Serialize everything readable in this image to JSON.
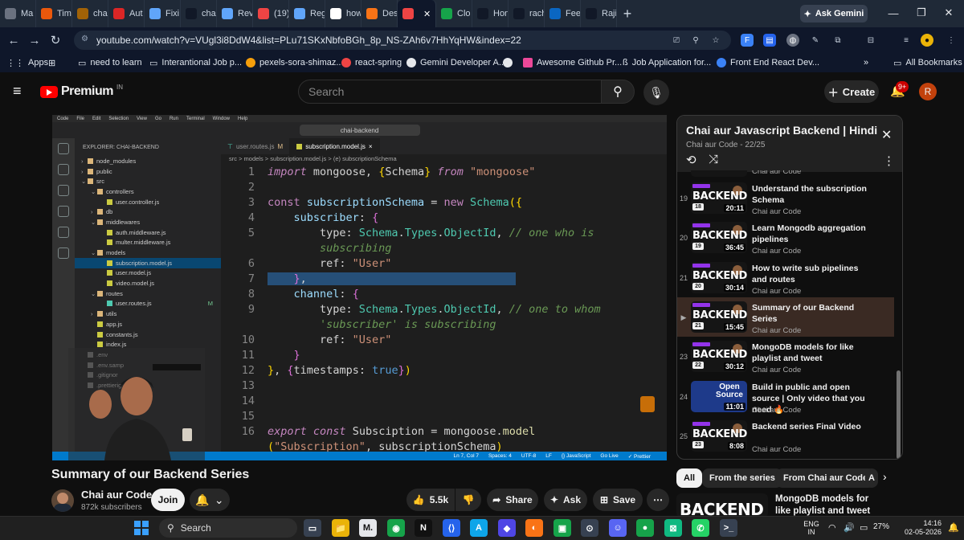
{
  "browser": {
    "tabs": [
      {
        "label": "Ma",
        "icon": "app-icon",
        "color": "#6b7280"
      },
      {
        "label": "Tim",
        "icon": "bookmark-icon",
        "color": "#ea580c"
      },
      {
        "label": "cha",
        "icon": "chai-icon",
        "color": "#a16207"
      },
      {
        "label": "Aut",
        "icon": "card-icon",
        "color": "#dc2626"
      },
      {
        "label": "Fixi",
        "icon": "gemini-icon",
        "color": "#60a5fa"
      },
      {
        "label": "cha",
        "icon": "github-icon",
        "color": "#111827"
      },
      {
        "label": "Rev",
        "icon": "gemini-icon",
        "color": "#60a5fa"
      },
      {
        "label": "(19)",
        "icon": "youtube-icon",
        "color": "#ef4444"
      },
      {
        "label": "Reg",
        "icon": "gemini-icon",
        "color": "#60a5fa"
      },
      {
        "label": "how",
        "icon": "google-icon",
        "color": "#ffffff"
      },
      {
        "label": "Desi",
        "icon": "claude-icon",
        "color": "#f97316"
      },
      {
        "label": "",
        "icon": "youtube-icon",
        "color": "#ef4444",
        "active": true
      },
      {
        "label": "Clo",
        "icon": "leaf-icon",
        "color": "#16a34a"
      },
      {
        "label": "Hon",
        "icon": "x-icon",
        "color": "#111827"
      },
      {
        "label": "rach",
        "icon": "github-icon",
        "color": "#111827"
      },
      {
        "label": "Fee",
        "icon": "linkedin-icon",
        "color": "#0a66c2"
      },
      {
        "label": "Rajil",
        "icon": "github-icon",
        "color": "#111827"
      }
    ],
    "ask_gemini": "Ask Gemini",
    "url": "youtube.com/watch?v=VUgl3i8DdW4&list=PLu71SKxNbfoBGh_8p_NS-ZAh6v7HhYqHW&index=22",
    "bookmarks": [
      {
        "label": "Apps",
        "color": "#9ca3af"
      },
      {
        "label": "need to learn",
        "color": "#9ca3af"
      },
      {
        "label": "Interantional Job p...",
        "color": "#9ca3af"
      },
      {
        "label": "pexels-sora-shimaz...",
        "color": "#f59e0b"
      },
      {
        "label": "react-spring",
        "color": "#ef4444"
      },
      {
        "label": "Gemini Developer A...",
        "color": "#e5e7eb"
      },
      {
        "label": "",
        "color": "#6b7280"
      },
      {
        "label": "Awesome Github Pr...",
        "color": "#ec4899"
      },
      {
        "label": "Job Application for...",
        "color": "#9ca3af"
      },
      {
        "label": "Front End React Dev...",
        "color": "#3b82f6"
      }
    ],
    "all_bookmarks": "All Bookmarks",
    "overflow": "»"
  },
  "youtube": {
    "logo": "Premium",
    "region": "IN",
    "search_placeholder": "Search",
    "create_label": "Create",
    "notifications": "9+",
    "avatar_letter": "R"
  },
  "video_frame": {
    "mac_menu": [
      "Code",
      "File",
      "Edit",
      "Selection",
      "View",
      "Go",
      "Run",
      "Terminal",
      "Window",
      "Help"
    ],
    "search": "chai-backend",
    "explorer_title": "EXPLORER: CHAI-BACKEND",
    "tree": [
      {
        "label": "node_modules",
        "indent": 0,
        "kind": "folder"
      },
      {
        "label": "public",
        "indent": 0,
        "kind": "folder"
      },
      {
        "label": "src",
        "indent": 0,
        "kind": "folder-open"
      },
      {
        "label": "controllers",
        "indent": 1,
        "kind": "folder-open"
      },
      {
        "label": "user.controller.js",
        "indent": 2,
        "kind": "js"
      },
      {
        "label": "db",
        "indent": 1,
        "kind": "folder"
      },
      {
        "label": "middlewares",
        "indent": 1,
        "kind": "folder-open"
      },
      {
        "label": "auth.middleware.js",
        "indent": 2,
        "kind": "js"
      },
      {
        "label": "multer.middleware.js",
        "indent": 2,
        "kind": "js"
      },
      {
        "label": "models",
        "indent": 1,
        "kind": "folder-open"
      },
      {
        "label": "subscription.model.js",
        "indent": 2,
        "kind": "js",
        "selected": true
      },
      {
        "label": "user.model.js",
        "indent": 2,
        "kind": "js"
      },
      {
        "label": "video.model.js",
        "indent": 2,
        "kind": "js"
      },
      {
        "label": "routes",
        "indent": 1,
        "kind": "folder-open"
      },
      {
        "label": "user.routes.js",
        "indent": 2,
        "kind": "route",
        "badge": "M"
      },
      {
        "label": "utils",
        "indent": 1,
        "kind": "folder"
      },
      {
        "label": "app.js",
        "indent": 1,
        "kind": "js"
      },
      {
        "label": "constants.js",
        "indent": 1,
        "kind": "js"
      },
      {
        "label": "index.js",
        "indent": 1,
        "kind": "js"
      },
      {
        "label": ".env",
        "indent": 0,
        "kind": "file"
      },
      {
        "label": ".env.samp",
        "indent": 0,
        "kind": "file"
      },
      {
        "label": ".gitignor",
        "indent": 0,
        "kind": "file"
      },
      {
        "label": ".prettierig",
        "indent": 0,
        "kind": "file"
      }
    ],
    "editor_tabs": [
      {
        "label": "user.routes.js",
        "badge": "M"
      },
      {
        "label": "subscription.model.js",
        "close": "×",
        "active": true
      }
    ],
    "breadcrumb": "src > models > subscription.model.js > (e) subscriptionSchema",
    "code_lines": [
      {
        "n": "1",
        "tokens": [
          [
            "kwi",
            "import"
          ],
          [
            "pl",
            " mongoose, "
          ],
          [
            "pn",
            "{"
          ],
          [
            "pl",
            "Schema"
          ],
          [
            "pn",
            "}"
          ],
          [
            "pl",
            " "
          ],
          [
            "kwi",
            "from"
          ],
          [
            "pl",
            " "
          ],
          [
            "st",
            "\"mongoose\""
          ]
        ]
      },
      {
        "n": "2",
        "tokens": []
      },
      {
        "n": "3",
        "tokens": [
          [
            "kw",
            "const"
          ],
          [
            "pl",
            " "
          ],
          [
            "id",
            "subscriptionSchema"
          ],
          [
            "pl",
            " = "
          ],
          [
            "kw",
            "new"
          ],
          [
            "pl",
            " "
          ],
          [
            "ty",
            "Schema"
          ],
          [
            "pn",
            "({"
          ]
        ]
      },
      {
        "n": "4",
        "tokens": [
          [
            "pl",
            "    "
          ],
          [
            "id",
            "subscriber"
          ],
          [
            "pl",
            ": "
          ],
          [
            "pk",
            "{"
          ]
        ]
      },
      {
        "n": "5",
        "tokens": [
          [
            "pl",
            "        type: "
          ],
          [
            "ty",
            "Schema"
          ],
          [
            "pl",
            "."
          ],
          [
            "ty",
            "Types"
          ],
          [
            "pl",
            "."
          ],
          [
            "ty",
            "ObjectId"
          ],
          [
            "pl",
            ", "
          ],
          [
            "cm",
            "// one who is"
          ]
        ]
      },
      {
        "n": "",
        "tokens": [
          [
            "pl",
            "        "
          ],
          [
            "cm",
            "subscribing"
          ]
        ]
      },
      {
        "n": "6",
        "tokens": [
          [
            "pl",
            "        ref: "
          ],
          [
            "st",
            "\"User\""
          ]
        ]
      },
      {
        "n": "7",
        "tokens": [
          [
            "pl",
            "    "
          ],
          [
            "pk",
            "}"
          ],
          [
            "pl",
            ","
          ]
        ],
        "hl": true
      },
      {
        "n": "8",
        "tokens": [
          [
            "pl",
            "    "
          ],
          [
            "id",
            "channel"
          ],
          [
            "pl",
            ": "
          ],
          [
            "pk",
            "{"
          ]
        ]
      },
      {
        "n": "9",
        "tokens": [
          [
            "pl",
            "        type: "
          ],
          [
            "ty",
            "Schema"
          ],
          [
            "pl",
            "."
          ],
          [
            "ty",
            "Types"
          ],
          [
            "pl",
            "."
          ],
          [
            "ty",
            "ObjectId"
          ],
          [
            "pl",
            ", "
          ],
          [
            "cm",
            "// one to whom"
          ]
        ]
      },
      {
        "n": "",
        "tokens": [
          [
            "pl",
            "        "
          ],
          [
            "cm",
            "'subscriber' is subscribing"
          ]
        ]
      },
      {
        "n": "10",
        "tokens": [
          [
            "pl",
            "        ref: "
          ],
          [
            "st",
            "\"User\""
          ]
        ]
      },
      {
        "n": "11",
        "tokens": [
          [
            "pl",
            "    "
          ],
          [
            "pk",
            "}"
          ]
        ]
      },
      {
        "n": "12",
        "tokens": [
          [
            "pn",
            "}"
          ],
          [
            "pl",
            ", "
          ],
          [
            "pk",
            "{"
          ],
          [
            "pl",
            "timestamps: "
          ],
          [
            "bl",
            "true"
          ],
          [
            "pk",
            "}"
          ],
          [
            "pn",
            ")"
          ]
        ]
      },
      {
        "n": "13",
        "tokens": []
      },
      {
        "n": "14",
        "tokens": []
      },
      {
        "n": "15",
        "tokens": []
      },
      {
        "n": "16",
        "tokens": [
          [
            "kwi",
            "export"
          ],
          [
            "pl",
            " "
          ],
          [
            "kwi",
            "const"
          ],
          [
            "pl",
            " Subsciption = mongoose."
          ],
          [
            "fn",
            "model"
          ]
        ]
      },
      {
        "n": "",
        "tokens": [
          [
            "pn",
            "("
          ],
          [
            "st",
            "\"Subscription\""
          ],
          [
            "pl",
            ", subscriptionSchema"
          ],
          [
            "pn",
            ")"
          ]
        ]
      }
    ],
    "status": [
      "Ln 7, Col 7",
      "Spaces: 4",
      "UTF-8",
      "LF",
      "{} JavaScript",
      "Go Live",
      "✓ Prettier"
    ]
  },
  "video": {
    "title": "Summary of our Backend Series",
    "channel": "Chai aur Code",
    "subscribers": "872k subscribers",
    "join": "Join",
    "likes": "5.5k",
    "share": "Share",
    "ask": "Ask",
    "save": "Save"
  },
  "playlist": {
    "title": "Chai aur Javascript Backend | Hindi",
    "subtitle": "Chai aur Code - 22/25",
    "thumb_word": "BACKEND",
    "items": [
      {
        "index": "19",
        "num": "18",
        "duration": "20:11",
        "title": "Understand the subscription Schema",
        "channel": "Chai aur Code"
      },
      {
        "index": "20",
        "num": "19",
        "duration": "36:45",
        "title": "Learn Mongodb aggregation pipelines",
        "channel": "Chai aur Code"
      },
      {
        "index": "21",
        "num": "20",
        "duration": "30:14",
        "title": "How to write sub pipelines and routes",
        "channel": "Chai aur Code"
      },
      {
        "index": "▶",
        "num": "21",
        "duration": "15:45",
        "title": "Summary of our Backend Series",
        "channel": "Chai aur Code",
        "current": true
      },
      {
        "index": "23",
        "num": "22",
        "duration": "30:12",
        "title": "MongoDB models for like playlist and tweet",
        "channel": "Chai aur Code"
      },
      {
        "index": "24",
        "num": "",
        "duration": "11:01",
        "title": "Build in public and open source | Only video that you need 🔥",
        "channel": "Chai aur Code",
        "special": "Open Source"
      },
      {
        "index": "25",
        "num": "23",
        "duration": "8:08",
        "title": "Backend series Final Video",
        "channel": "Chai aur Code"
      }
    ]
  },
  "chips": [
    "All",
    "From the series",
    "From Chai aur Code",
    "A"
  ],
  "recommendation": {
    "title": "MongoDB models for like playlist and tweet",
    "thumb_word": "BACKEND"
  },
  "taskbar": {
    "search": "Search",
    "apps": [
      {
        "label": "▭",
        "color": "#374151"
      },
      {
        "label": "📁",
        "color": "#eab308"
      },
      {
        "label": "M.",
        "color": "#e5e7eb"
      },
      {
        "label": "◉",
        "color": "#16a34a"
      },
      {
        "label": "N",
        "color": "#111111"
      },
      {
        "label": "⟨⟩",
        "color": "#2563eb"
      },
      {
        "label": "A",
        "color": "#0ea5e9"
      },
      {
        "label": "◆",
        "color": "#4f46e5"
      },
      {
        "label": "◐",
        "color": "#f97316"
      },
      {
        "label": "▣",
        "color": "#16a34a"
      },
      {
        "label": "⊙",
        "color": "#374151"
      },
      {
        "label": "☺",
        "color": "#5865f2"
      },
      {
        "label": "●",
        "color": "#16a34a"
      },
      {
        "label": "⊠",
        "color": "#10b981"
      },
      {
        "label": "✆",
        "color": "#25d366"
      },
      {
        "label": ">_",
        "color": "#374151"
      }
    ],
    "lang": "ENG",
    "region": "IN",
    "battery": "27%",
    "time": "14:16",
    "date": "02-05-2026"
  }
}
